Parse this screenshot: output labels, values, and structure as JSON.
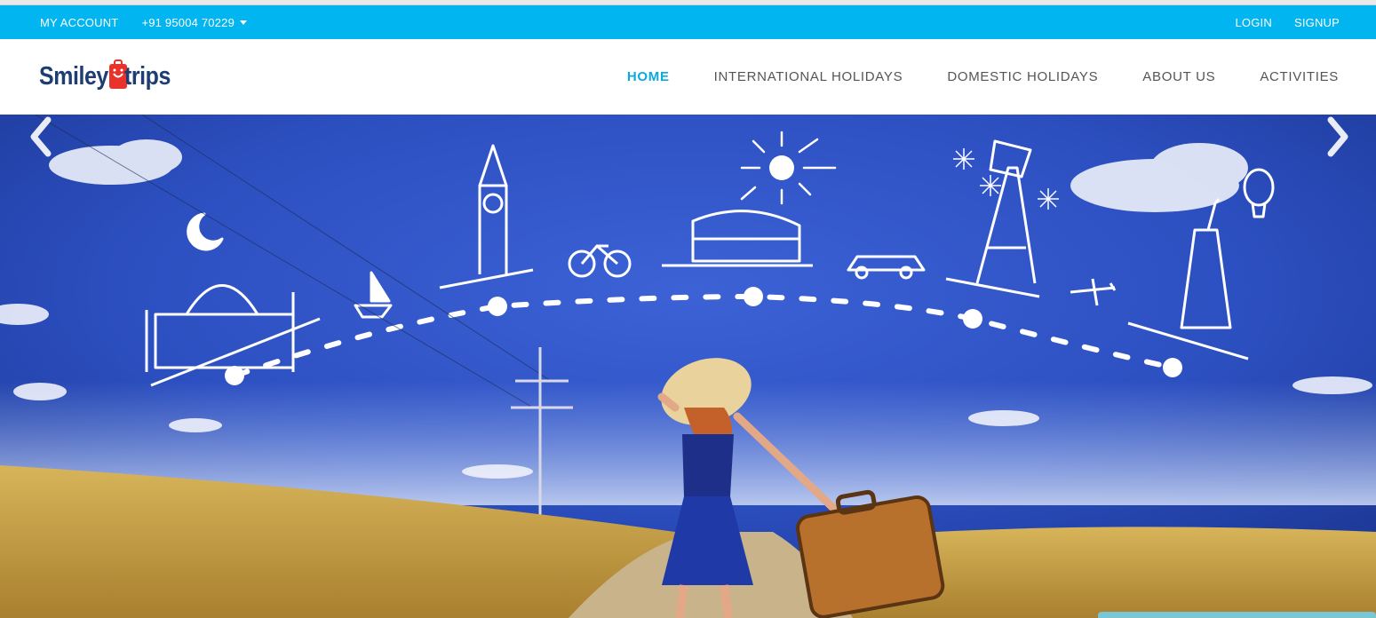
{
  "topbar": {
    "my_account": "MY ACCOUNT",
    "phone": "+91 95004 70229",
    "login": "LOGIN",
    "signup": "SIGNUP"
  },
  "brand": {
    "name_part1": "Smiley",
    "name_part2": "trips",
    "colors": {
      "primary": "#1d3d73",
      "accent": "#e8322b"
    }
  },
  "nav": {
    "items": [
      {
        "label": "HOME",
        "active": true
      },
      {
        "label": "INTERNATIONAL HOLIDAYS",
        "active": false
      },
      {
        "label": "DOMESTIC HOLIDAYS",
        "active": false
      },
      {
        "label": "ABOUT US",
        "active": false
      },
      {
        "label": "ACTIVITIES",
        "active": false
      }
    ]
  },
  "hero": {
    "prev_icon": "chevron-left-icon",
    "next_icon": "chevron-right-icon"
  },
  "colors": {
    "topbar": "#00b5f0",
    "nav_active": "#0aa9e0",
    "nav_text": "#555555"
  }
}
